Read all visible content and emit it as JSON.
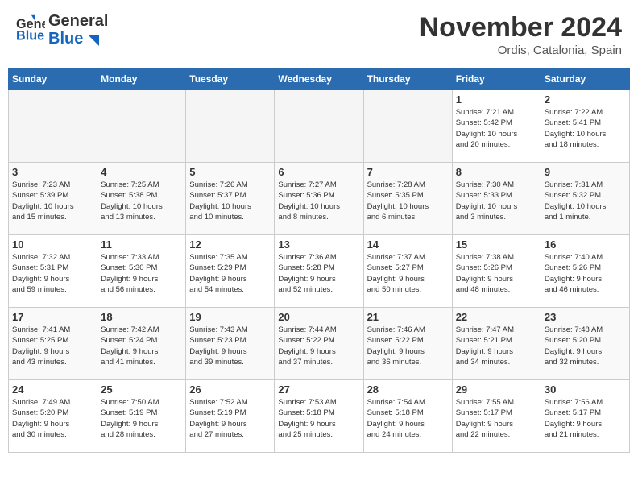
{
  "header": {
    "logo_general": "General",
    "logo_blue": "Blue",
    "month": "November 2024",
    "location": "Ordis, Catalonia, Spain"
  },
  "days_of_week": [
    "Sunday",
    "Monday",
    "Tuesday",
    "Wednesday",
    "Thursday",
    "Friday",
    "Saturday"
  ],
  "weeks": [
    [
      {
        "day": "",
        "info": ""
      },
      {
        "day": "",
        "info": ""
      },
      {
        "day": "",
        "info": ""
      },
      {
        "day": "",
        "info": ""
      },
      {
        "day": "",
        "info": ""
      },
      {
        "day": "1",
        "info": "Sunrise: 7:21 AM\nSunset: 5:42 PM\nDaylight: 10 hours\nand 20 minutes."
      },
      {
        "day": "2",
        "info": "Sunrise: 7:22 AM\nSunset: 5:41 PM\nDaylight: 10 hours\nand 18 minutes."
      }
    ],
    [
      {
        "day": "3",
        "info": "Sunrise: 7:23 AM\nSunset: 5:39 PM\nDaylight: 10 hours\nand 15 minutes."
      },
      {
        "day": "4",
        "info": "Sunrise: 7:25 AM\nSunset: 5:38 PM\nDaylight: 10 hours\nand 13 minutes."
      },
      {
        "day": "5",
        "info": "Sunrise: 7:26 AM\nSunset: 5:37 PM\nDaylight: 10 hours\nand 10 minutes."
      },
      {
        "day": "6",
        "info": "Sunrise: 7:27 AM\nSunset: 5:36 PM\nDaylight: 10 hours\nand 8 minutes."
      },
      {
        "day": "7",
        "info": "Sunrise: 7:28 AM\nSunset: 5:35 PM\nDaylight: 10 hours\nand 6 minutes."
      },
      {
        "day": "8",
        "info": "Sunrise: 7:30 AM\nSunset: 5:33 PM\nDaylight: 10 hours\nand 3 minutes."
      },
      {
        "day": "9",
        "info": "Sunrise: 7:31 AM\nSunset: 5:32 PM\nDaylight: 10 hours\nand 1 minute."
      }
    ],
    [
      {
        "day": "10",
        "info": "Sunrise: 7:32 AM\nSunset: 5:31 PM\nDaylight: 9 hours\nand 59 minutes."
      },
      {
        "day": "11",
        "info": "Sunrise: 7:33 AM\nSunset: 5:30 PM\nDaylight: 9 hours\nand 56 minutes."
      },
      {
        "day": "12",
        "info": "Sunrise: 7:35 AM\nSunset: 5:29 PM\nDaylight: 9 hours\nand 54 minutes."
      },
      {
        "day": "13",
        "info": "Sunrise: 7:36 AM\nSunset: 5:28 PM\nDaylight: 9 hours\nand 52 minutes."
      },
      {
        "day": "14",
        "info": "Sunrise: 7:37 AM\nSunset: 5:27 PM\nDaylight: 9 hours\nand 50 minutes."
      },
      {
        "day": "15",
        "info": "Sunrise: 7:38 AM\nSunset: 5:26 PM\nDaylight: 9 hours\nand 48 minutes."
      },
      {
        "day": "16",
        "info": "Sunrise: 7:40 AM\nSunset: 5:26 PM\nDaylight: 9 hours\nand 46 minutes."
      }
    ],
    [
      {
        "day": "17",
        "info": "Sunrise: 7:41 AM\nSunset: 5:25 PM\nDaylight: 9 hours\nand 43 minutes."
      },
      {
        "day": "18",
        "info": "Sunrise: 7:42 AM\nSunset: 5:24 PM\nDaylight: 9 hours\nand 41 minutes."
      },
      {
        "day": "19",
        "info": "Sunrise: 7:43 AM\nSunset: 5:23 PM\nDaylight: 9 hours\nand 39 minutes."
      },
      {
        "day": "20",
        "info": "Sunrise: 7:44 AM\nSunset: 5:22 PM\nDaylight: 9 hours\nand 37 minutes."
      },
      {
        "day": "21",
        "info": "Sunrise: 7:46 AM\nSunset: 5:22 PM\nDaylight: 9 hours\nand 36 minutes."
      },
      {
        "day": "22",
        "info": "Sunrise: 7:47 AM\nSunset: 5:21 PM\nDaylight: 9 hours\nand 34 minutes."
      },
      {
        "day": "23",
        "info": "Sunrise: 7:48 AM\nSunset: 5:20 PM\nDaylight: 9 hours\nand 32 minutes."
      }
    ],
    [
      {
        "day": "24",
        "info": "Sunrise: 7:49 AM\nSunset: 5:20 PM\nDaylight: 9 hours\nand 30 minutes."
      },
      {
        "day": "25",
        "info": "Sunrise: 7:50 AM\nSunset: 5:19 PM\nDaylight: 9 hours\nand 28 minutes."
      },
      {
        "day": "26",
        "info": "Sunrise: 7:52 AM\nSunset: 5:19 PM\nDaylight: 9 hours\nand 27 minutes."
      },
      {
        "day": "27",
        "info": "Sunrise: 7:53 AM\nSunset: 5:18 PM\nDaylight: 9 hours\nand 25 minutes."
      },
      {
        "day": "28",
        "info": "Sunrise: 7:54 AM\nSunset: 5:18 PM\nDaylight: 9 hours\nand 24 minutes."
      },
      {
        "day": "29",
        "info": "Sunrise: 7:55 AM\nSunset: 5:17 PM\nDaylight: 9 hours\nand 22 minutes."
      },
      {
        "day": "30",
        "info": "Sunrise: 7:56 AM\nSunset: 5:17 PM\nDaylight: 9 hours\nand 21 minutes."
      }
    ]
  ]
}
